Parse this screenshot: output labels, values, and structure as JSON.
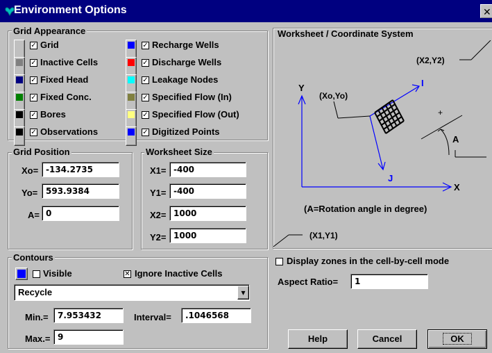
{
  "window": {
    "title": "Environment Options",
    "close_glyph": "✕"
  },
  "grid_appearance": {
    "label": "Grid Appearance",
    "items": [
      {
        "label": "Grid",
        "checked": true,
        "color": "#c0c0c0"
      },
      {
        "label": "Inactive Cells",
        "checked": true,
        "color": "#808080"
      },
      {
        "label": "Fixed Head",
        "checked": true,
        "color": "#000080"
      },
      {
        "label": "Fixed Conc.",
        "checked": true,
        "color": "#008000"
      },
      {
        "label": "Bores",
        "checked": true,
        "color": "#000000"
      },
      {
        "label": "Observations",
        "checked": true,
        "color": "#000000"
      },
      {
        "label": "Recharge Wells",
        "checked": true,
        "color": "#0000ff"
      },
      {
        "label": "Discharge Wells",
        "checked": true,
        "color": "#ff0000"
      },
      {
        "label": "Leakage Nodes",
        "checked": true,
        "color": "#00ffff"
      },
      {
        "label": "Specified Flow (In)",
        "checked": true,
        "color": "#808040"
      },
      {
        "label": "Specified Flow (Out)",
        "checked": true,
        "color": "#ffff80"
      },
      {
        "label": "Digitized Points",
        "checked": true,
        "color": "#0000ff"
      }
    ]
  },
  "grid_position": {
    "label": "Grid Position",
    "xo_label": "Xo=",
    "xo_value": "-134.2735",
    "yo_label": "Yo=",
    "yo_value": "593.9384",
    "a_label": "A=",
    "a_value": "0"
  },
  "worksheet_size": {
    "label": "Worksheet Size",
    "x1_label": "X1=",
    "x1_value": "-400",
    "y1_label": "Y1=",
    "y1_value": "-400",
    "x2_label": "X2=",
    "x2_value": "1000",
    "y2_label": "Y2=",
    "y2_value": "1000"
  },
  "coordinate_system": {
    "label": "Worksheet / Coordinate System",
    "x2y2": "(X2,Y2)",
    "x1y1": "(X1,Y1)",
    "origin": "(Xo,Yo)",
    "axis_y": "Y",
    "axis_x": "X",
    "axis_i": "I",
    "axis_j": "J",
    "angle": "A",
    "note": "(A=Rotation angle in degree)"
  },
  "contours": {
    "label": "Contours",
    "visible_label": "Visible",
    "visible_checked": false,
    "color": "#0000ff",
    "ignore_label": "Ignore Inactive Cells",
    "ignore_checked": true,
    "select_value": "Recycle",
    "min_label": "Min.=",
    "min_value": "7.953432",
    "interval_label": "Interval=",
    "interval_value": ".1046568",
    "max_label": "Max.=",
    "max_value": "9"
  },
  "display_zones": {
    "label": "Display zones in the cell-by-cell mode",
    "checked": false
  },
  "aspect": {
    "label": "Aspect Ratio=",
    "value": "1"
  },
  "buttons": {
    "help": "Help",
    "cancel": "Cancel",
    "ok": "OK"
  },
  "glyphs": {
    "check_on": "✓",
    "check_x": "✕",
    "dropdown": "▾"
  }
}
